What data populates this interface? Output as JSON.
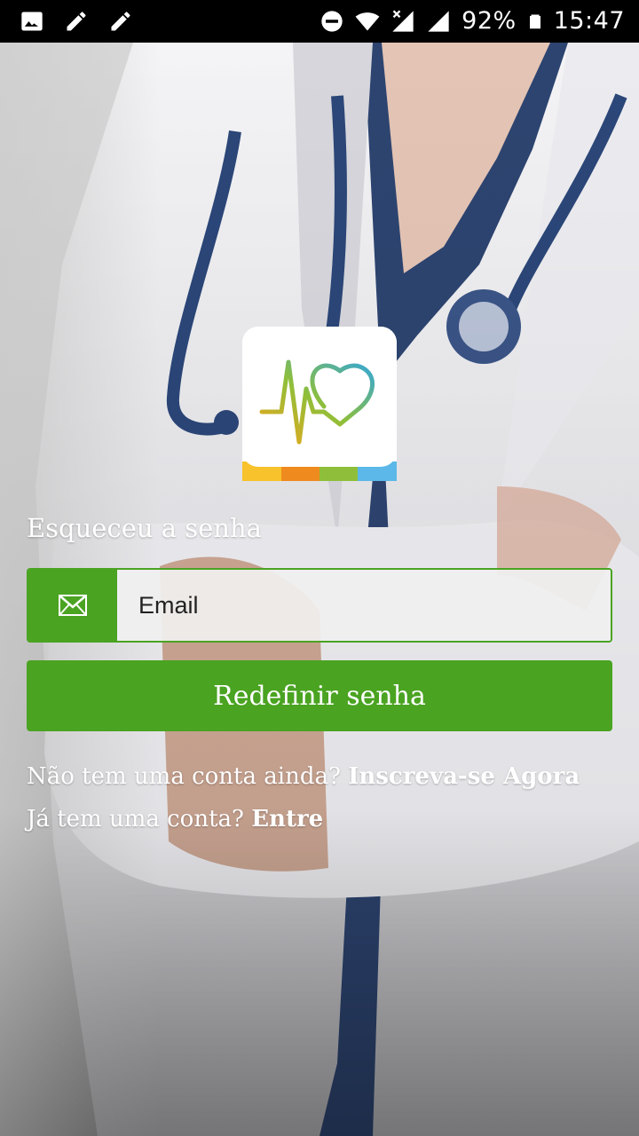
{
  "status_bar": {
    "battery": "92%",
    "time": "15:47",
    "left_icons": [
      "image-icon",
      "pencil-icon",
      "pencil-icon"
    ],
    "right_icons": [
      "do-not-disturb-icon",
      "wifi-icon",
      "signal-off-icon",
      "signal-icon",
      "battery-icon"
    ]
  },
  "form": {
    "title": "Esqueceu a senha",
    "email_placeholder": "Email",
    "email_value": "",
    "submit_label": "Redefinir senha"
  },
  "footer": {
    "signup_prompt": "Não tem uma conta ainda?",
    "signup_link": "Inscreva-se Agora",
    "login_prompt": "Já tem uma conta?",
    "login_link": "Entre"
  },
  "colors": {
    "accent": "#4aa321",
    "status_bar": "#000000",
    "text": "#ffffff"
  }
}
